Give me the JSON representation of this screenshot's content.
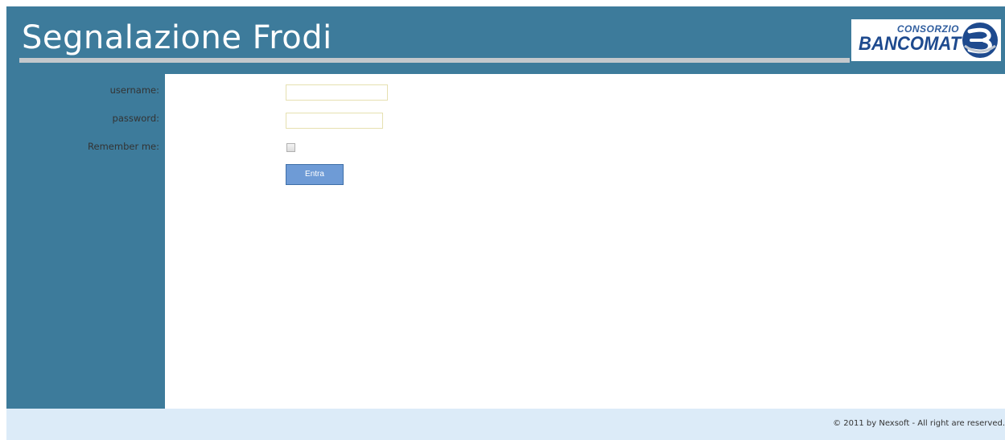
{
  "header": {
    "title": "Segnalazione Frodi",
    "logo": {
      "top_word": "CONSORZIO",
      "main_word": "BANCOMAT",
      "icon": "bancomat-b-logo-icon"
    }
  },
  "login_form": {
    "username_label": "username:",
    "username_value": "",
    "password_label": "password:",
    "password_value": "",
    "remember_label": "Remember me:",
    "remember_checked": false,
    "submit_label": "Entra"
  },
  "footer": {
    "copyright": "© 2011 by Nexsoft - All right are reserved."
  },
  "colors": {
    "header_bg": "#3d7b9b",
    "sidebar_bg": "#3d7b9b",
    "footer_bg": "#dcebf8",
    "button_bg": "#6e9bd6",
    "logo_blue": "#1e4a8e"
  }
}
